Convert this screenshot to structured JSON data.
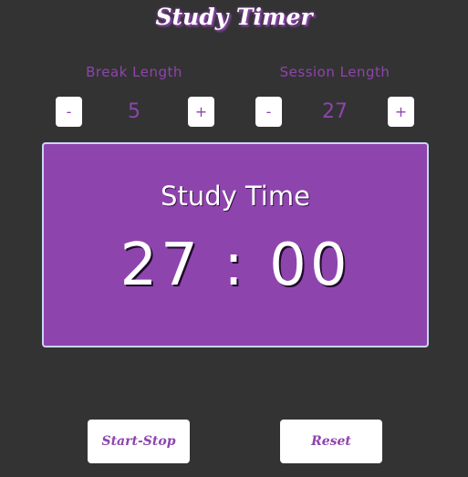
{
  "app": {
    "title": "Study Timer"
  },
  "break": {
    "label": "Break Length",
    "decrement_label": "-",
    "increment_label": "+",
    "value": "5"
  },
  "session": {
    "label": "Session Length",
    "decrement_label": "-",
    "increment_label": "+",
    "value": "27"
  },
  "timer": {
    "label": "Study Time",
    "time_left": "27 : 00"
  },
  "controls": {
    "start_stop_label": "Start-Stop",
    "reset_label": "Reset"
  },
  "colors": {
    "background": "#333333",
    "accent": "#8e44ad",
    "button_bg": "#ffffff",
    "timer_border": "#c9d6f5"
  }
}
